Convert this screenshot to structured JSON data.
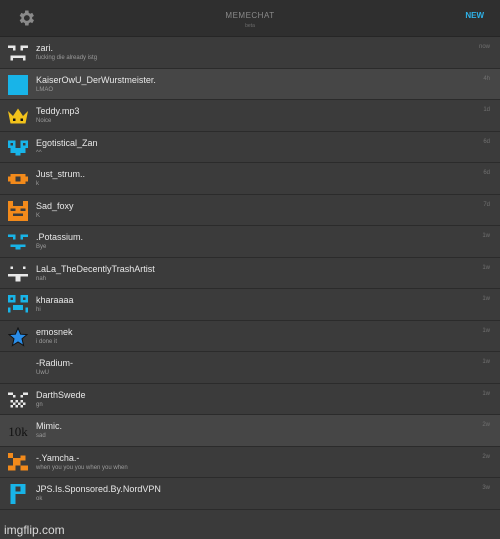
{
  "header": {
    "settings_icon": "gear-icon",
    "title": "MEMECHAT",
    "subtitle": "beta",
    "new_label": "NEW"
  },
  "chats": [
    {
      "name": "zari.",
      "message": "fucking die already istg",
      "time": "now",
      "icon": "face-icon-white",
      "color": "#e8e8e8"
    },
    {
      "name": "KaiserOwU_DerWurstmeister.",
      "message": "LMAO",
      "time": "4h",
      "icon": "square-avatar",
      "color": "#18b4e8"
    },
    {
      "name": "Teddy.mp3",
      "message": "Noice",
      "time": "1d",
      "icon": "crown-icon",
      "color": "#f2c21b"
    },
    {
      "name": "Egotistical_Zan",
      "message": "^^",
      "time": "6d",
      "icon": "heart-face-icon",
      "color": "#18b4e8"
    },
    {
      "name": "Just_strum..",
      "message": "k",
      "time": "6d",
      "icon": "eye-face-icon",
      "color": "#f28a1b"
    },
    {
      "name": "Sad_foxy",
      "message": "K",
      "time": "7d",
      "icon": "fox-face-icon",
      "color": "#f28a1b"
    },
    {
      "name": ".Potassium.",
      "message": "Bye",
      "time": "1w",
      "icon": "face-icon-blue",
      "color": "#18b4e8"
    },
    {
      "name": "LaLa_TheDecentlyTrashArtist",
      "message": "nah",
      "time": "1w",
      "icon": "face-icon-white",
      "color": "#e8e8e8"
    },
    {
      "name": "kharaaaa",
      "message": "hi",
      "time": "1w",
      "icon": "pixel-face-icon",
      "color": "#18b4e8"
    },
    {
      "name": "emosnek",
      "message": "i done it",
      "time": "1w",
      "icon": "star-icon",
      "color": "#2a8de8"
    },
    {
      "name": "-Radium-",
      "message": "UwU",
      "time": "1w",
      "icon": "",
      "color": ""
    },
    {
      "name": "DarthSwede",
      "message": "gn",
      "time": "1w",
      "icon": "checker-face-icon",
      "color": "#e8e8e8"
    },
    {
      "name": "Mimic.",
      "message": "sad",
      "time": "2w",
      "icon": "10k-badge",
      "color": "#111111",
      "badge_text": "10k"
    },
    {
      "name": "-.Yamcha.-",
      "message": "when you you you when you when",
      "time": "2w",
      "icon": "creature-icon",
      "color": "#f28a1b"
    },
    {
      "name": "JPS.Is.Sponsored.By.NordVPN",
      "message": "ok",
      "time": "3w",
      "icon": "p-letter-icon",
      "color": "#18b4e8"
    }
  ],
  "watermark": "imgflip.com"
}
